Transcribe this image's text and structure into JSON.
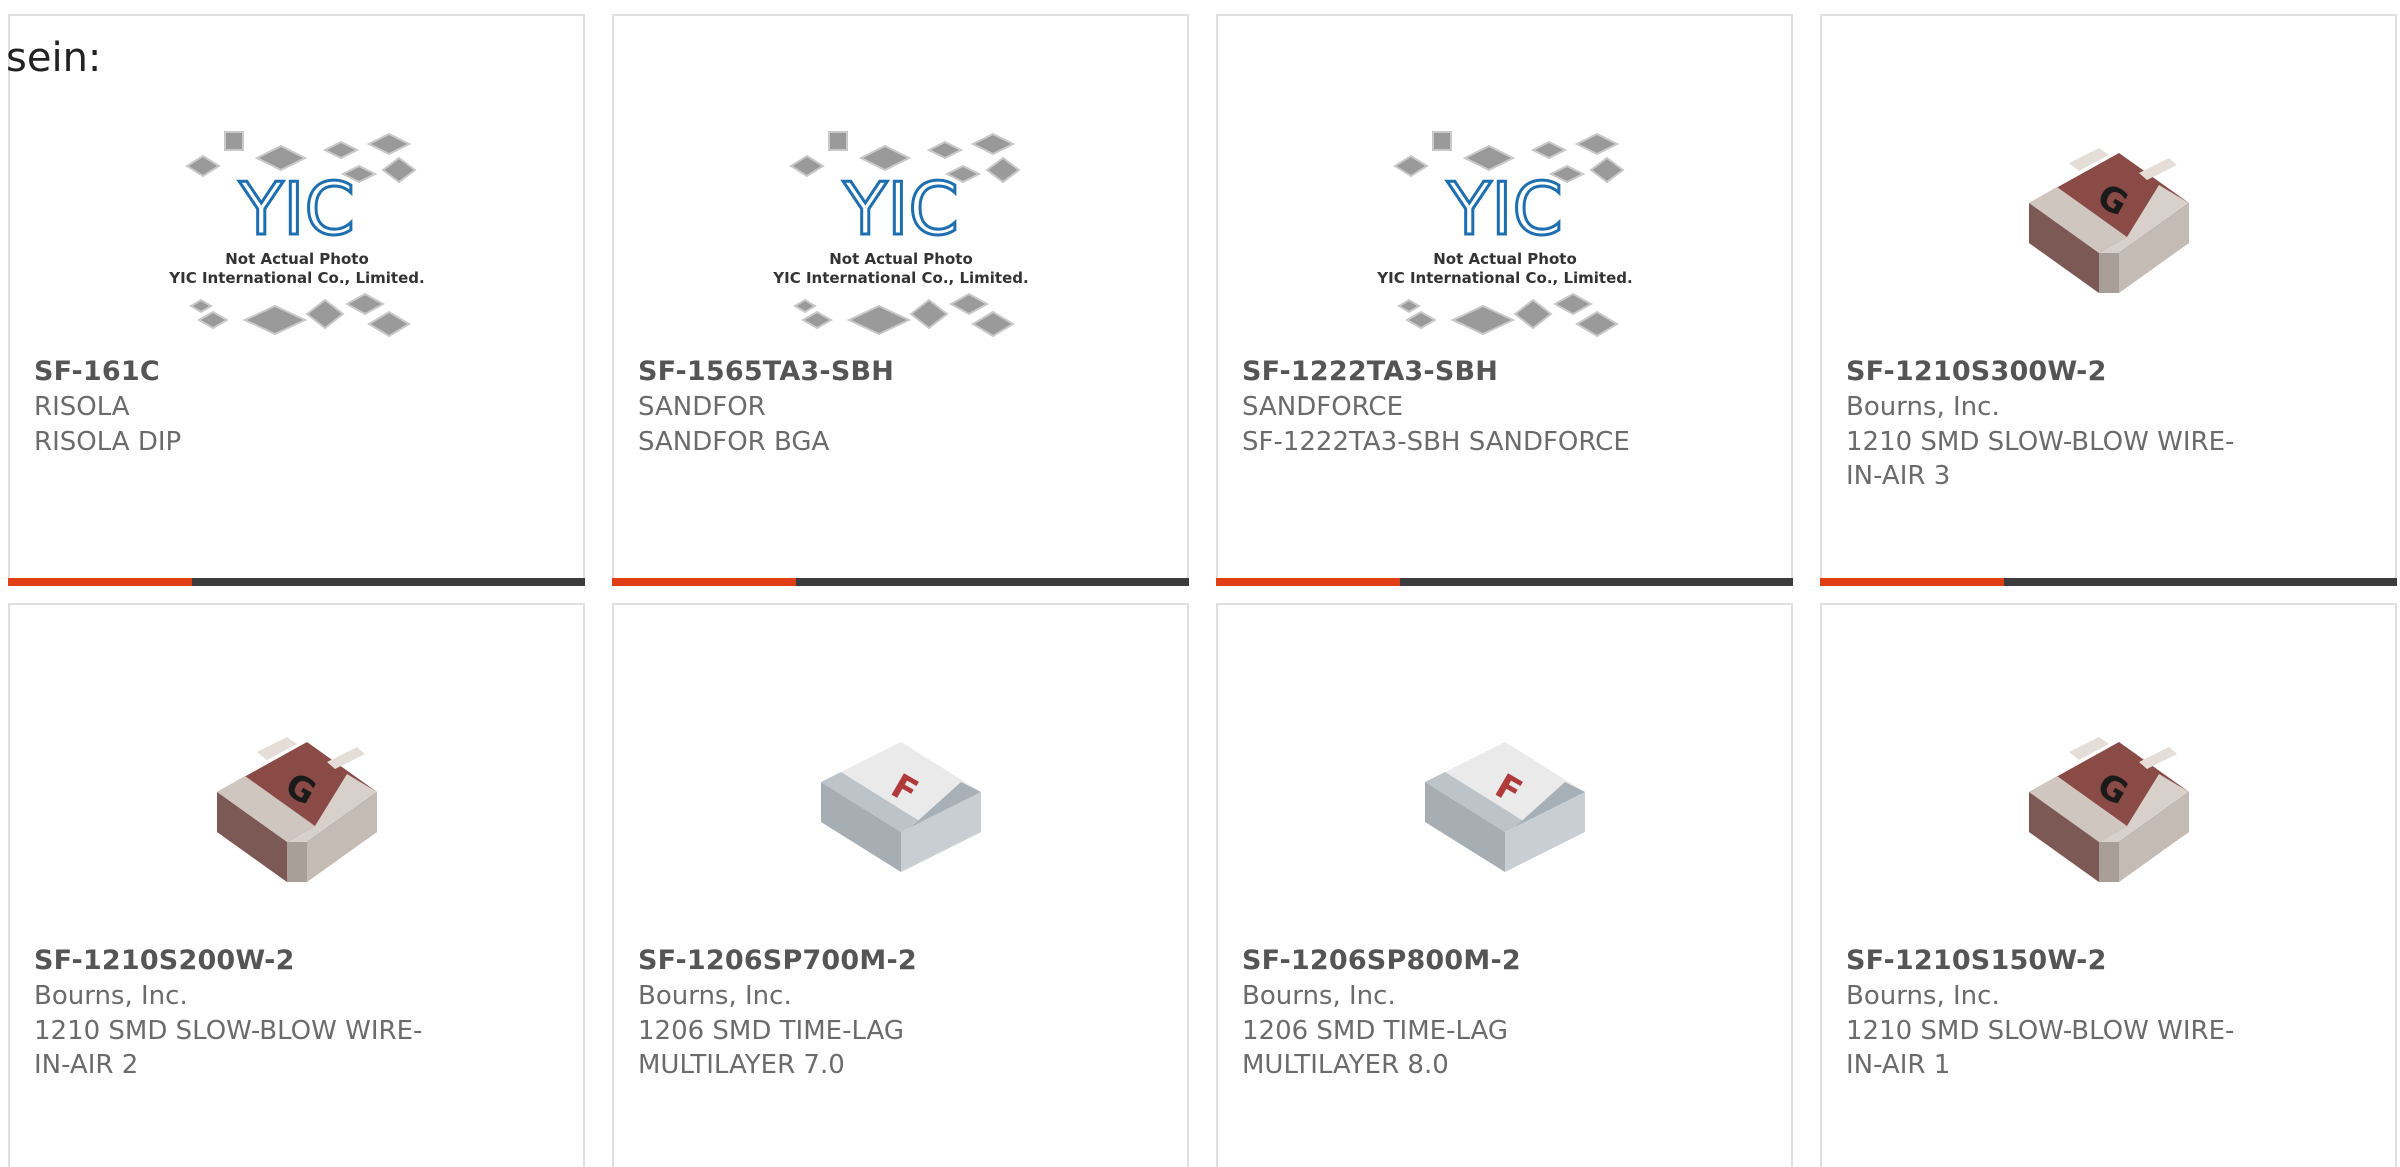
{
  "intro_text": "sein:",
  "placeholder": {
    "line1": "Not Actual Photo",
    "line2": "YIC International Co., Limited.",
    "logo": "YIC"
  },
  "colors": {
    "accent": "#e03e14",
    "bar_dark": "#3c3c3c",
    "card_border": "#e0e0e0",
    "text_bold": "#555555",
    "text_muted": "#6b6b6b"
  },
  "products": [
    {
      "part_number": "SF-161C",
      "manufacturer": "RISOLA",
      "description": "RISOLA DIP",
      "image": "yic-placeholder"
    },
    {
      "part_number": "SF-1565TA3-SBH",
      "manufacturer": "SANDFOR",
      "description": "SANDFOR BGA",
      "image": "yic-placeholder"
    },
    {
      "part_number": "SF-1222TA3-SBH",
      "manufacturer": "SANDFORCE",
      "description": "SF-1222TA3-SBH SANDFORCE",
      "image": "yic-placeholder"
    },
    {
      "part_number": "SF-1210S300W-2",
      "manufacturer": "Bourns, Inc.",
      "description": "1210 SMD SLOW-BLOW WIRE-IN-AIR 3",
      "image": "fuse-brown-g",
      "chip_letter": "G"
    },
    {
      "part_number": "SF-1210S200W-2",
      "manufacturer": "Bourns, Inc.",
      "description": "1210 SMD SLOW-BLOW WIRE-IN-AIR 2",
      "image": "fuse-brown-g",
      "chip_letter": "G"
    },
    {
      "part_number": "SF-1206SP700M-2",
      "manufacturer": "Bourns, Inc.",
      "description": "1206 SMD TIME-LAG MULTILAYER 7.0",
      "image": "fuse-white-f",
      "chip_letter": "F"
    },
    {
      "part_number": "SF-1206SP800M-2",
      "manufacturer": "Bourns, Inc.",
      "description": "1206 SMD TIME-LAG MULTILAYER 8.0",
      "image": "fuse-white-f",
      "chip_letter": "F"
    },
    {
      "part_number": "SF-1210S150W-2",
      "manufacturer": "Bourns, Inc.",
      "description": "1210 SMD SLOW-BLOW WIRE-IN-AIR 1",
      "image": "fuse-brown-g",
      "chip_letter": "G"
    }
  ]
}
